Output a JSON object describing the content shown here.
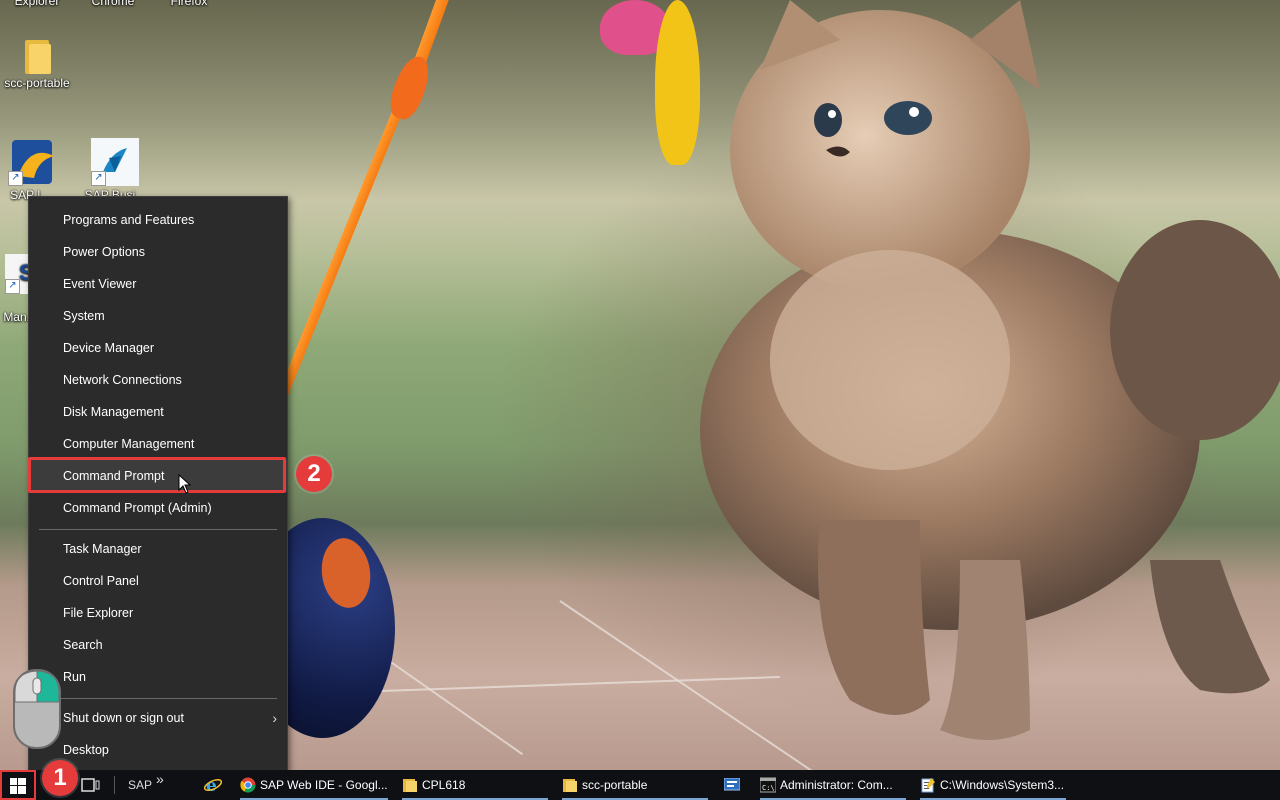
{
  "desktop": {
    "top_labels": [
      "Explorer",
      "Chrome",
      "Firefox"
    ],
    "icons": [
      {
        "label": "scc-portable"
      },
      {
        "label": "SAP L..."
      },
      {
        "label": "SAP Busi..."
      },
      {
        "label": "Man..."
      }
    ]
  },
  "context_menu": {
    "items": [
      {
        "label": "Programs and Features"
      },
      {
        "label": "Power Options"
      },
      {
        "label": "Event Viewer"
      },
      {
        "label": "System"
      },
      {
        "label": "Device Manager"
      },
      {
        "label": "Network Connections"
      },
      {
        "label": "Disk Management"
      },
      {
        "label": "Computer Management"
      },
      {
        "label": "Command Prompt"
      },
      {
        "label": "Command Prompt (Admin)"
      },
      {
        "label": "Task Manager"
      },
      {
        "label": "Control Panel"
      },
      {
        "label": "File Explorer"
      },
      {
        "label": "Search"
      },
      {
        "label": "Run"
      },
      {
        "label": "Shut down or sign out"
      },
      {
        "label": "Desktop"
      }
    ],
    "highlighted_item": "Command Prompt"
  },
  "annotations": {
    "step1": "1",
    "step2": "2",
    "highlight_color": "#e53b3b"
  },
  "taskbar": {
    "toolbar_label": "SAP",
    "overflow": "»",
    "buttons": [
      {
        "label": "SAP Web IDE - Googl...",
        "icon": "chrome-icon"
      },
      {
        "label": "CPL618",
        "icon": "folder-icon"
      },
      {
        "label": "scc-portable",
        "icon": "folder-icon"
      },
      {
        "label": "Administrator: Com...",
        "icon": "cmd-icon"
      },
      {
        "label": "C:\\Windows\\System3...",
        "icon": "notepad-icon"
      }
    ]
  },
  "colors": {
    "menu_bg": "#2b2b2b",
    "taskbar_bg": "#0f1014",
    "annotation_red": "#e53b3b"
  }
}
